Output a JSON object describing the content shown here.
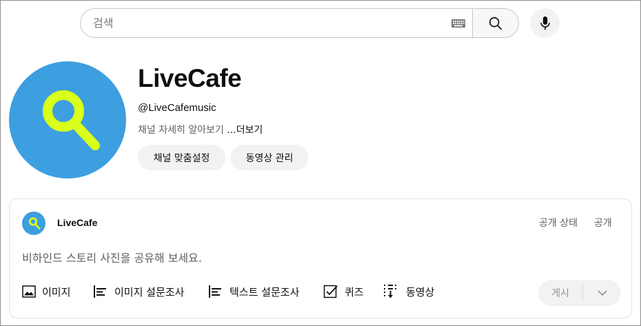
{
  "search": {
    "placeholder": "검색"
  },
  "icons": {
    "keyboard": "keyboard-icon",
    "search": "search-icon",
    "mic": "mic-icon",
    "avatar": "magnifier-logo-icon",
    "image": "image-icon",
    "poll": "poll-icon",
    "quiz": "checkbox-icon",
    "video": "video-icon",
    "chevron": "chevron-down-icon"
  },
  "colors": {
    "avatar_bg": "#3d9fe0",
    "avatar_fg": "#d9ff1a"
  },
  "channel": {
    "name": "LiveCafe",
    "handle": "@LiveCafemusic",
    "description": "채널 자세히 알아보기",
    "more_label": "...더보기",
    "customize_label": "채널 맞춤설정",
    "manage_label": "동영상 관리"
  },
  "composer": {
    "author": "LiveCafe",
    "visibility_label": "공개 상태",
    "visibility_value": "공개",
    "prompt": "비하인드 스토리 사진을 공유해 보세요.",
    "tools": {
      "image": "이미지",
      "image_poll": "이미지 설문조사",
      "text_poll": "텍스트 설문조사",
      "quiz": "퀴즈",
      "video": "동영상"
    },
    "post_label": "게시"
  }
}
